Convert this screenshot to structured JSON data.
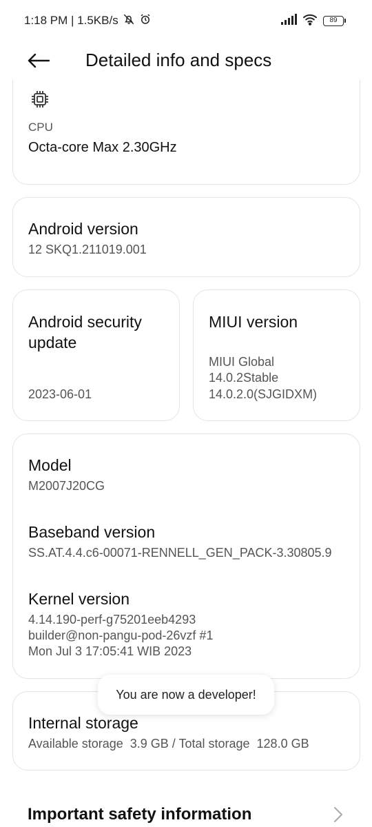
{
  "status": {
    "time_speed": "1:18 PM | 1.5KB/s",
    "battery": "89"
  },
  "header": {
    "title": "Detailed info and specs"
  },
  "cpu": {
    "label": "CPU",
    "value": "Octa-core Max 2.30GHz"
  },
  "android_version": {
    "label": "Android version",
    "value": "12 SKQ1.211019.001"
  },
  "security_update": {
    "label_line1": "Android security",
    "label_line2": "update",
    "value": "2023-06-01"
  },
  "miui_version": {
    "label": "MIUI version",
    "value_line1": "MIUI Global",
    "value_line2": "14.0.2Stable",
    "value_line3": "14.0.2.0(SJGIDXM)"
  },
  "model": {
    "label": "Model",
    "value": "M2007J20CG"
  },
  "baseband": {
    "label": "Baseband version",
    "value": "SS.AT.4.4.c6-00071-RENNELL_GEN_PACK-3.30805.9"
  },
  "kernel": {
    "label": "Kernel version",
    "value_line1": "4.14.190-perf-g75201eeb4293",
    "value_line2": "builder@non-pangu-pod-26vzf #1",
    "value_line3": "Mon Jul 3 17:05:41 WIB 2023"
  },
  "storage": {
    "label": "Internal storage",
    "value": "Available storage  3.9 GB / Total storage  128.0 GB"
  },
  "toast": {
    "text": "You are now a developer!"
  },
  "safety": {
    "label": "Important safety information"
  }
}
